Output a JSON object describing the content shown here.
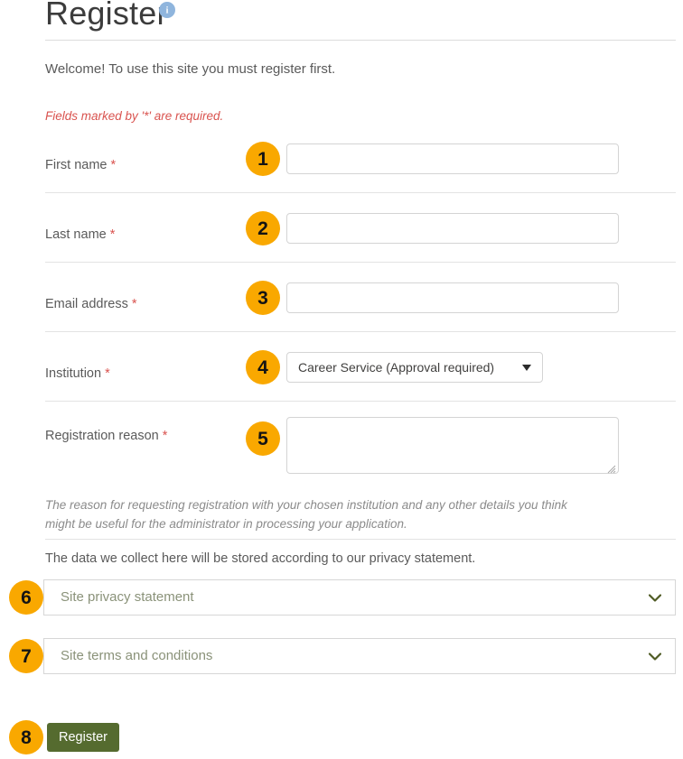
{
  "header": {
    "title": "Register",
    "info_icon": "info-circle-icon"
  },
  "intro": {
    "welcome": "Welcome! To use this site you must register first.",
    "required_note": "Fields marked by '*' are required."
  },
  "form": {
    "fields": [
      {
        "label": "First name",
        "required_marker": "*",
        "type": "text",
        "value": "",
        "placeholder": "",
        "step": "1"
      },
      {
        "label": "Last name",
        "required_marker": "*",
        "type": "text",
        "value": "",
        "placeholder": "",
        "step": "2"
      },
      {
        "label": "Email address",
        "required_marker": "*",
        "type": "text",
        "value": "",
        "placeholder": "",
        "step": "3"
      },
      {
        "label": "Institution",
        "required_marker": "*",
        "type": "select",
        "value": "Career Service (Approval required)",
        "step": "4"
      },
      {
        "label": "Registration reason",
        "required_marker": "*",
        "type": "textarea",
        "value": "",
        "placeholder": "",
        "step": "5"
      }
    ],
    "registration_reason_help": "The reason for requesting registration with your chosen institution and any other details you think might be useful for the administrator in processing your application.",
    "privacy_note": "The data we collect here will be stored according to our privacy statement."
  },
  "accordions": [
    {
      "label": "Site privacy statement",
      "chevron": "chevron-down-icon",
      "step": "6"
    },
    {
      "label": "Site terms and conditions",
      "chevron": "chevron-down-icon",
      "step": "7"
    }
  ],
  "actions": {
    "register_label": "Register",
    "register_step": "8"
  },
  "colors": {
    "step_badge": "#f9a800",
    "required_star": "#d9534f",
    "register_button": "#556b2f",
    "info_icon": "#8fb5dd",
    "accordion_text": "#8a9279"
  }
}
